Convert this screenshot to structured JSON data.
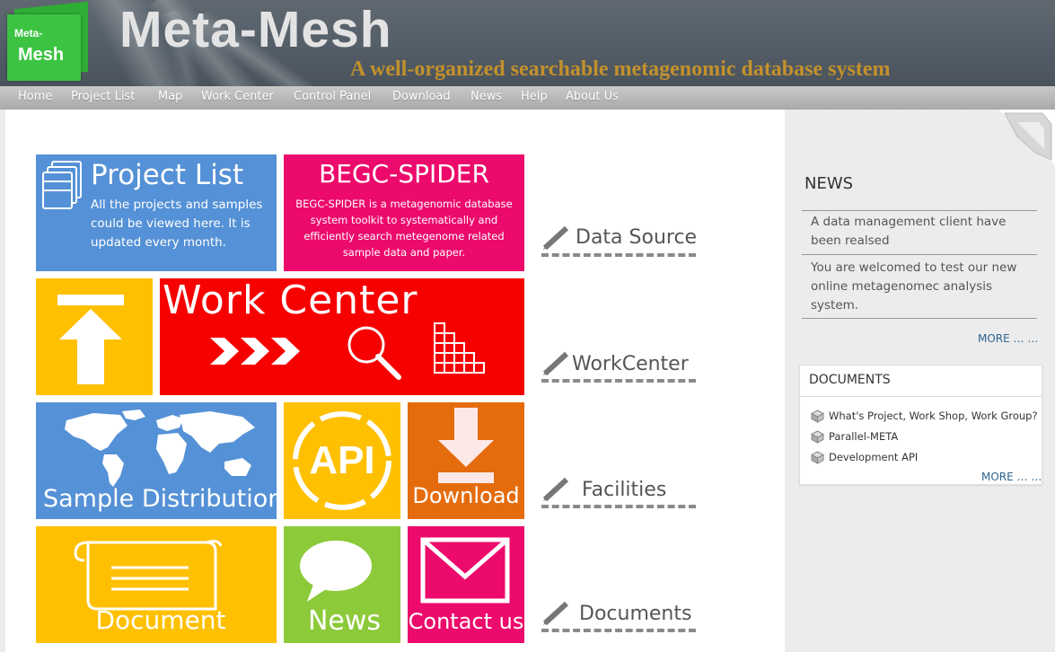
{
  "header": {
    "logo_line1": "Meta-",
    "logo_line2": "Mesh",
    "title": "Meta-Mesh",
    "tagline": "A well-organized searchable metagenomic database system"
  },
  "nav": {
    "items": [
      "Home",
      "Project List",
      "Map",
      "Work Center",
      "Control Panel",
      "Download",
      "News",
      "Help",
      "About Us"
    ]
  },
  "tiles": {
    "project_list": {
      "title": "Project List",
      "desc_lines": [
        "All the projects and samples",
        "could be viewed here. It is",
        "updated every month."
      ]
    },
    "begc": {
      "title": "BEGC-SPIDER",
      "desc_lines": [
        "BEGC-SPIDER is a metagenomic database",
        "system toolkit to systematically and",
        "efficiently search metegenome related",
        "sample data and paper."
      ]
    },
    "work_center": {
      "title": "Work Center"
    },
    "sample_distribution": {
      "title": "Sample Distribution"
    },
    "api": {
      "title": "API"
    },
    "download": {
      "title": "Download"
    },
    "document": {
      "title": "Document"
    },
    "news": {
      "title": "News"
    },
    "contact": {
      "title": "Contact us"
    }
  },
  "sections": [
    "Data Source",
    "WorkCenter",
    "Facilities",
    "Documents"
  ],
  "sidebar": {
    "news_heading": "NEWS",
    "news_items": [
      [
        "A data management client have",
        "been realsed"
      ],
      [
        "You are welcomed to test our new",
        "online metagenomec analysis",
        "system."
      ]
    ],
    "news_more": "MORE … …",
    "docs_heading": "DOCUMENTS",
    "doc_items": [
      "What's Project, Work Shop, Work Group?",
      "Parallel-META",
      "Development API"
    ],
    "docs_more": "MORE … …"
  },
  "colors": {
    "blue": "#5591d6",
    "magenta": "#ec0a6c",
    "yellow": "#ffc000",
    "red": "#f70000",
    "orange": "#e56c0d",
    "green": "#8cca3a"
  }
}
